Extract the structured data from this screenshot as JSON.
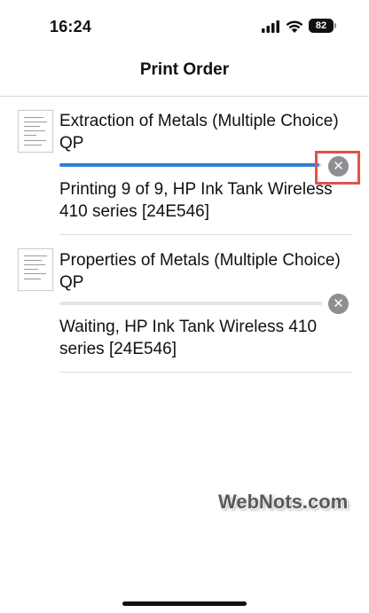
{
  "status_bar": {
    "time": "16:24",
    "battery": "82",
    "icons": [
      "signal-icon",
      "wifi-icon",
      "battery-icon"
    ]
  },
  "nav": {
    "title": "Print Order"
  },
  "jobs": [
    {
      "title": "Extraction of Metals (Multiple Choice) QP",
      "status": "Printing 9 of 9, HP Ink Tank Wireless 410 series [24E546]",
      "progress": 0.99,
      "cancel_icon": "close-icon"
    },
    {
      "title": "Properties of Metals (Multiple Choice) QP",
      "status": "Waiting, HP Ink Tank Wireless 410 series [24E546]",
      "progress": 0,
      "cancel_icon": "close-icon"
    }
  ],
  "colors": {
    "progress": "#2f7fd6",
    "cancel_button": "#8e8e93",
    "highlight": "#e2524a"
  },
  "watermark": "WebNots.com"
}
